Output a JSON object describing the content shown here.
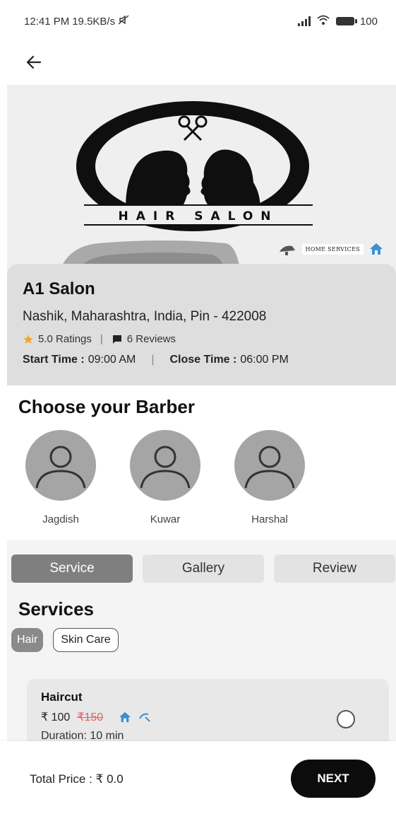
{
  "status_bar": {
    "time": "12:41 PM",
    "speed": "19.5KB/s",
    "battery": "100"
  },
  "hero": {
    "logo_text": "HAIR SALON",
    "badge_label": "HOME SERVICES"
  },
  "salon": {
    "name": "A1 Salon",
    "address": "Nashik, Maharashtra, India, Pin - 422008",
    "ratings": "5.0 Ratings",
    "reviews": "6 Reviews",
    "start_label": "Start Time :",
    "start_time": "09:00 AM",
    "close_label": "Close Time :",
    "close_time": "06:00 PM"
  },
  "barbers_section": {
    "title": "Choose your Barber",
    "barbers": [
      {
        "name": "Jagdish"
      },
      {
        "name": "Kuwar"
      },
      {
        "name": "Harshal"
      }
    ]
  },
  "tabs": [
    {
      "label": "Service",
      "active": true
    },
    {
      "label": "Gallery",
      "active": false
    },
    {
      "label": "Review",
      "active": false
    }
  ],
  "services": {
    "title": "Services",
    "categories": [
      {
        "label": "Hair",
        "active": true
      },
      {
        "label": "Skin Care",
        "active": false
      }
    ],
    "items": [
      {
        "name": "Haircut",
        "price": "₹ 100",
        "old_price": "₹150",
        "duration": "Duration: 10 min",
        "selected": false
      }
    ]
  },
  "footer": {
    "total": "Total Price : ₹ 0.0",
    "next_label": "NEXT"
  },
  "colors": {
    "active_tab": "#7f7f7f",
    "next_button": "#0c0c0c",
    "star": "#f5a623",
    "home_icon": "#3b8fd6",
    "old_price": "#e06060"
  }
}
